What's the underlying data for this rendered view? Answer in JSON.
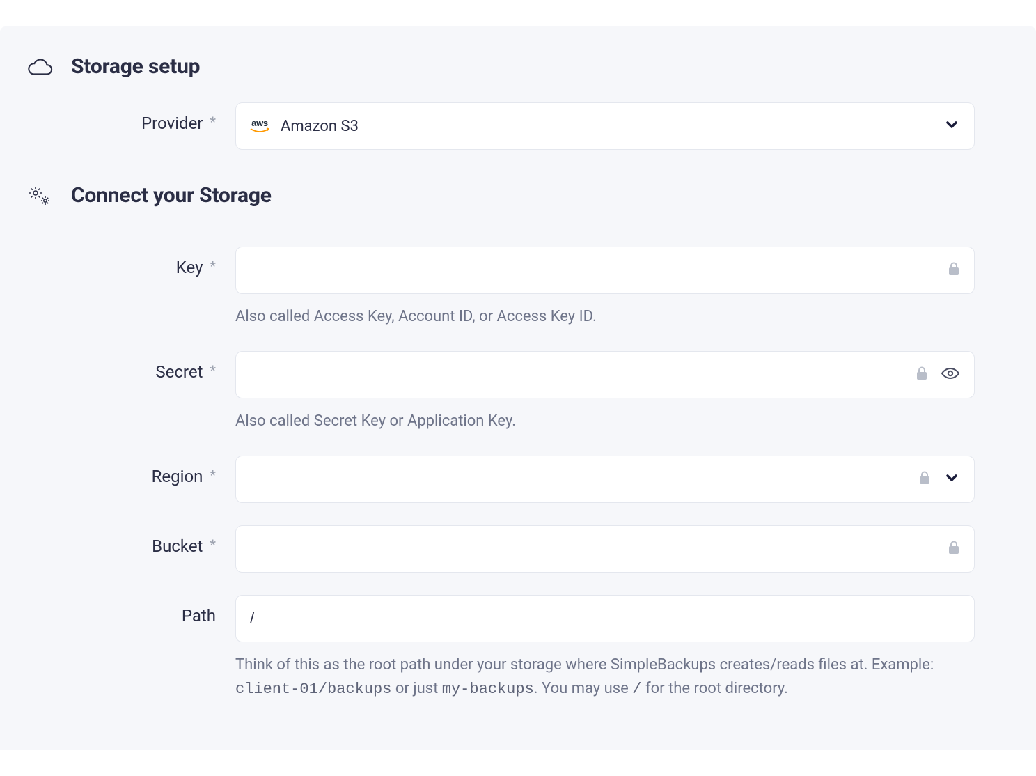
{
  "sections": {
    "storage_setup": {
      "title": "Storage setup"
    },
    "connect_storage": {
      "title": "Connect your Storage"
    }
  },
  "form": {
    "provider": {
      "label": "Provider",
      "required": true,
      "selected": "Amazon S3"
    },
    "key": {
      "label": "Key",
      "required": true,
      "value": "",
      "help": "Also called Access Key, Account ID, or Access Key ID."
    },
    "secret": {
      "label": "Secret",
      "required": true,
      "value": "",
      "help": "Also called Secret Key or Application Key."
    },
    "region": {
      "label": "Region",
      "required": true,
      "value": ""
    },
    "bucket": {
      "label": "Bucket",
      "required": true,
      "value": ""
    },
    "path": {
      "label": "Path",
      "required": false,
      "value": "/",
      "help_pre": "Think of this as the root path under your storage where SimpleBackups creates/reads files at. Example: ",
      "help_code1": "client-01/backups",
      "help_mid": " or just ",
      "help_code2": "my-backups",
      "help_post1": ". You may use ",
      "help_code3": "/",
      "help_post2": " for the root directory."
    }
  },
  "glyphs": {
    "asterisk": "*"
  }
}
